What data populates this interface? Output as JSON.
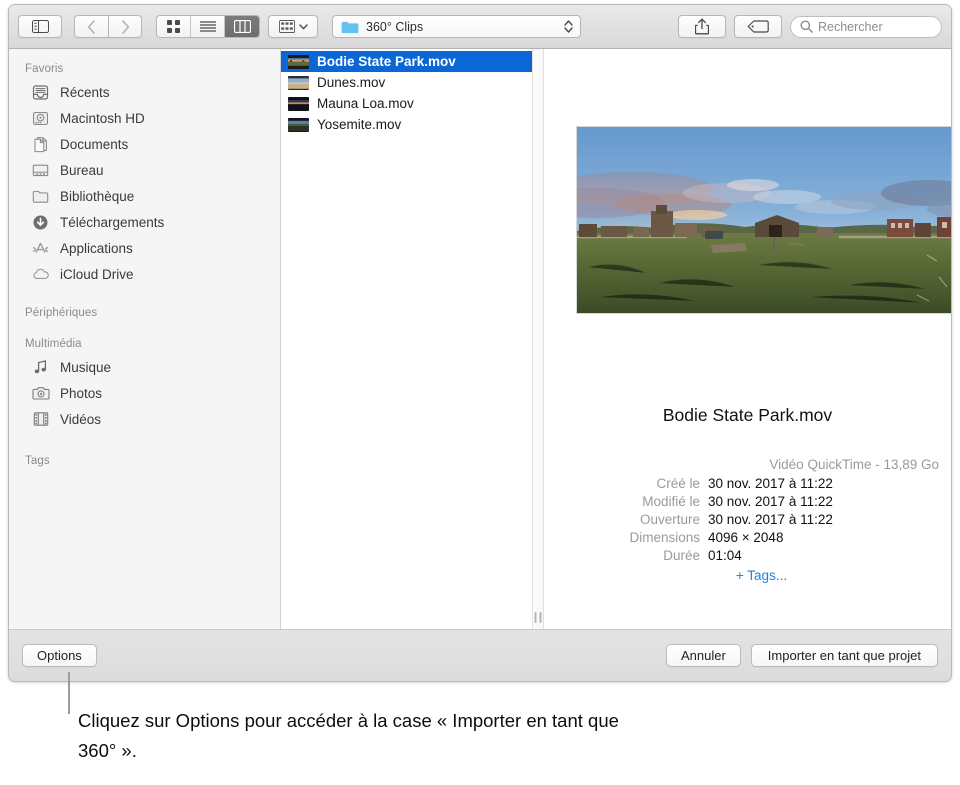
{
  "window": {
    "title": "Import dialog"
  },
  "toolbar": {
    "sidebar_toggle": "sidebar-toggle",
    "back_label": "Précédent",
    "forward_label": "Suivant",
    "view_icon_label": "Icônes",
    "view_list_label": "Liste",
    "view_column_label": "Colonnes",
    "view_selected": "view_column",
    "arrange_label": "Grouper",
    "path_label": "360° Clips",
    "share_label": "Partager",
    "tag_label": "Tags",
    "search_placeholder": "Rechercher"
  },
  "sidebar": {
    "sections": [
      {
        "header": "Favoris",
        "items": [
          {
            "label": "Récents",
            "icon": "recents-icon"
          },
          {
            "label": "Macintosh HD",
            "icon": "harddisk-icon"
          },
          {
            "label": "Documents",
            "icon": "documents-icon"
          },
          {
            "label": "Bureau",
            "icon": "desktop-icon"
          },
          {
            "label": "Bibliothèque",
            "icon": "folder-icon"
          },
          {
            "label": "Téléchargements",
            "icon": "downloads-icon"
          },
          {
            "label": "Applications",
            "icon": "applications-icon"
          },
          {
            "label": "iCloud Drive",
            "icon": "icloud-icon"
          }
        ]
      },
      {
        "header": "Périphériques",
        "items": []
      },
      {
        "header": "Multimédia",
        "items": [
          {
            "label": "Musique",
            "icon": "music-note-icon"
          },
          {
            "label": "Photos",
            "icon": "camera-icon"
          },
          {
            "label": "Vidéos",
            "icon": "film-icon"
          }
        ]
      },
      {
        "header": "Tags",
        "items": []
      }
    ]
  },
  "file_list": {
    "items": [
      {
        "name": "Bodie State Park.mov",
        "selected": true
      },
      {
        "name": "Dunes.mov",
        "selected": false
      },
      {
        "name": "Mauna Loa.mov",
        "selected": false
      },
      {
        "name": "Yosemite.mov",
        "selected": false
      }
    ]
  },
  "preview": {
    "image_alt": "Panorama 360° d'une ville fantôme au coucher du soleil",
    "title": "Bodie State Park.mov",
    "kind_and_size": "Vidéo QuickTime - 13,89 Go",
    "fields": [
      {
        "key": "Créé le",
        "value": "30 nov. 2017 à 11:22"
      },
      {
        "key": "Modifié le",
        "value": "30 nov. 2017 à 11:22"
      },
      {
        "key": "Ouverture",
        "value": "30 nov. 2017 à 11:22"
      },
      {
        "key": "Dimensions",
        "value": "4096 × 2048"
      },
      {
        "key": "Durée",
        "value": "01:04"
      }
    ],
    "add_tags": "+ Tags..."
  },
  "bottom_bar": {
    "options_label": "Options",
    "cancel_label": "Annuler",
    "import_label": "Importer en tant que projet"
  },
  "callout": {
    "text": "Cliquez sur Options pour accéder à la case « Importer en tant que 360° »."
  },
  "colors": {
    "selection_blue": "#0c67d6",
    "link_blue": "#2b7de0",
    "sidebar_bg": "#f5f5f5",
    "toolbar_top": "#e9e9e9",
    "toolbar_bottom": "#d9d9d9",
    "folder_blue": "#63c3f0"
  }
}
